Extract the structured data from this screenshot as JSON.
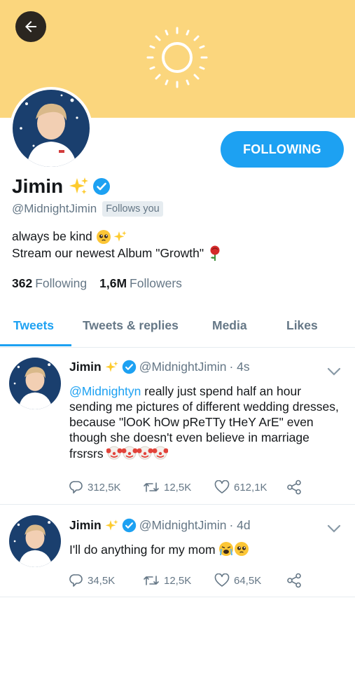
{
  "header": {
    "back_icon": "arrow-left-icon",
    "banner_color": "#fbd67d"
  },
  "profile": {
    "name": "Jimin",
    "handle": "@MidnightJimin",
    "follows_you": "Follows you",
    "follow_button": "FOLLOWING",
    "verified_icon": "verified-badge-icon",
    "bio_line1": "always be kind",
    "bio_line2": "Stream our newest Album \"Growth\"",
    "following_count": "362",
    "following_label": "Following",
    "followers_count": "1,6M",
    "followers_label": "Followers"
  },
  "tabs": [
    {
      "label": "Tweets",
      "active": true
    },
    {
      "label": "Tweets & replies",
      "active": false
    },
    {
      "label": "Media",
      "active": false
    },
    {
      "label": "Likes",
      "active": false
    }
  ],
  "tweets": [
    {
      "name": "Jimin",
      "handle": "@MidnightJimin",
      "time": "· 4s",
      "mention": "@Midnightyn",
      "text": " really just spend half an hour sending me pictures of different wedding dresses, because \"lOoK hOw pReTTy tHeY ArE\" even though she doesn't even believe in marriage frsrsrs",
      "replies": "312,5K",
      "retweets": "12,5K",
      "likes": "612,1K"
    },
    {
      "name": "Jimin",
      "handle": "@MidnightJimin",
      "time": "· 4d",
      "text": "I'll do anything for my mom",
      "replies": "34,5K",
      "retweets": "12,5K",
      "likes": "64,5K"
    }
  ],
  "colors": {
    "accent": "#1da1f2",
    "muted": "#657786",
    "text": "#14171a"
  }
}
